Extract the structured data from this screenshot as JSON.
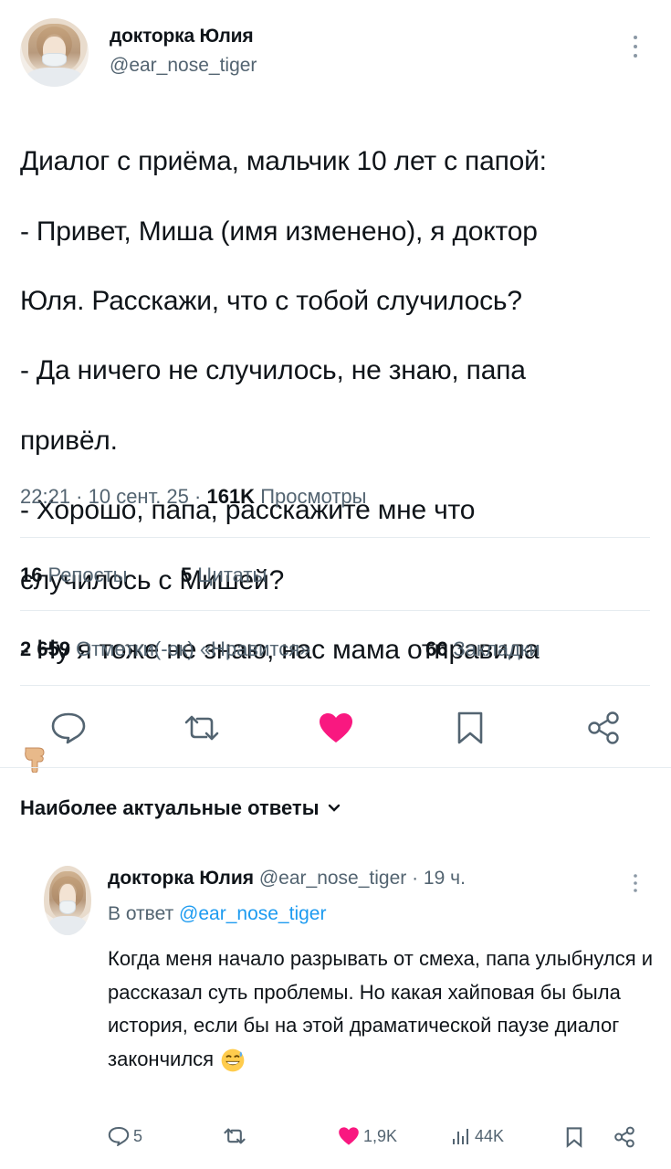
{
  "tweet": {
    "author_name": "докторка Юлия",
    "author_handle": "@ear_nose_tiger",
    "text_lines": [
      "Диалог с приёма, мальчик 10 лет с папой:",
      "- Привет, Миша (имя изменено), я доктор",
      "Юля. Расскажи, что с тобой случилось?",
      "- Да ничего не случилось, не знаю, папа",
      "привёл.",
      "- Хорошо, папа, расскажите мне что",
      "случилось с Мишей?",
      "- Ну я тоже не знаю, нас мама отправила"
    ],
    "emoji": "pointing-down-hand",
    "time_date": "22:21 · 10 сент. 25 ·",
    "views_count": "161K",
    "views_label": "Просмотры"
  },
  "stats": {
    "reposts_count": "16",
    "reposts_label": "Репосты",
    "quotes_count": "5",
    "quotes_label": "Цитаты",
    "likes_count": "2 659",
    "likes_label": "Отметки(-ок) «Нравится»",
    "bookmarks_count": "66",
    "bookmarks_label": "Закладки"
  },
  "actions": {
    "icons": [
      "reply-icon",
      "retweet-icon",
      "like-icon",
      "bookmark-icon",
      "share-icon"
    ],
    "like_color": "#f91880"
  },
  "replies_section": {
    "title": "Наиболее актуальные ответы"
  },
  "reply": {
    "author_name": "докторка Юлия",
    "author_handle": "@ear_nose_tiger",
    "time": "· 19 ч.",
    "reply_to_label": "В ответ",
    "reply_to_handle": "@ear_nose_tiger",
    "text": "Когда меня начало разрывать от смеха, папа улыбнулся и рассказал суть проблемы. Но какая хайповая бы была история, если бы на этой драматической паузе диалог закончился",
    "emoji": "grinning-sweat-face",
    "reply_count": "5",
    "like_count": "1,9K",
    "views_count": "44K"
  },
  "colors": {
    "text": "#0f1419",
    "secondary": "#536471",
    "link": "#1d9bf0",
    "divider": "#e6ecf0"
  }
}
